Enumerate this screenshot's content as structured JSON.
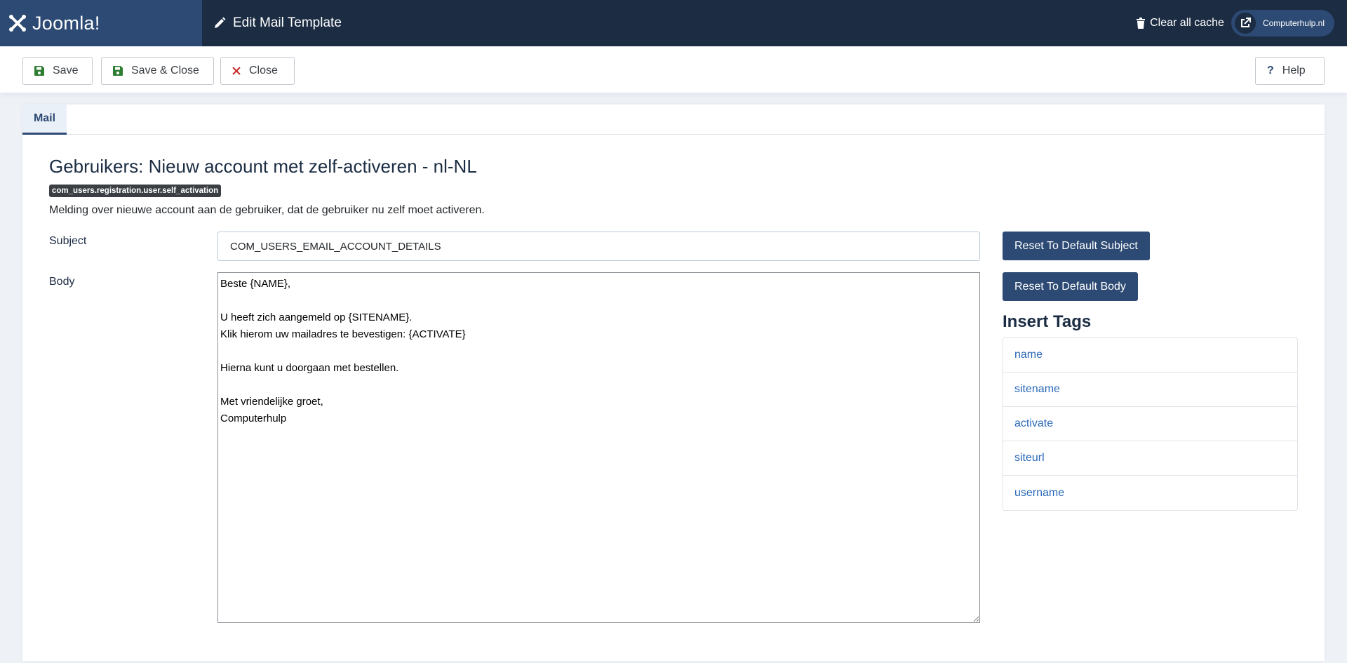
{
  "header": {
    "logo_text": "Joomla!",
    "page_title": "Edit Mail Template",
    "clear_cache_label": "Clear all cache",
    "site_label": "Computerhulp.nl"
  },
  "toolbar": {
    "save_label": "Save",
    "save_close_label": "Save & Close",
    "close_label": "Close",
    "help_label": "Help"
  },
  "tabs": [
    {
      "label": "Mail"
    }
  ],
  "form": {
    "title": "Gebruikers: Nieuw account met zelf-activeren - nl-NL",
    "template_key": "com_users.registration.user.self_activation",
    "description": "Melding over nieuwe account aan de gebruiker, dat de gebruiker nu zelf moet activeren.",
    "subject_label": "Subject",
    "subject_value": "COM_USERS_EMAIL_ACCOUNT_DETAILS",
    "body_label": "Body",
    "body_value": "Beste {NAME},\n\nU heeft zich aangemeld op {SITENAME}.\nKlik hierom uw mailadres te bevestigen: {ACTIVATE}\n\nHierna kunt u doorgaan met bestellen.\n\nMet vriendelijke groet,\nComputerhulp",
    "reset_subject_label": "Reset To Default Subject",
    "reset_body_label": "Reset To Default Body"
  },
  "insert_tags": {
    "title": "Insert Tags",
    "items": [
      "name",
      "sitename",
      "activate",
      "siteurl",
      "username"
    ]
  },
  "colors": {
    "header_bg": "#1b2c43",
    "logo_bg": "#2c4a73",
    "primary_button": "#2c4a73",
    "link": "#2a69b8",
    "save_icon": "#2e7d32",
    "close_icon": "#c62828"
  },
  "icons": {
    "logo": "joomla-logo-icon",
    "edit": "pencil-icon",
    "trash": "trash-icon",
    "external": "external-link-icon",
    "save": "save-icon",
    "close": "x-icon",
    "help": "question-icon"
  }
}
